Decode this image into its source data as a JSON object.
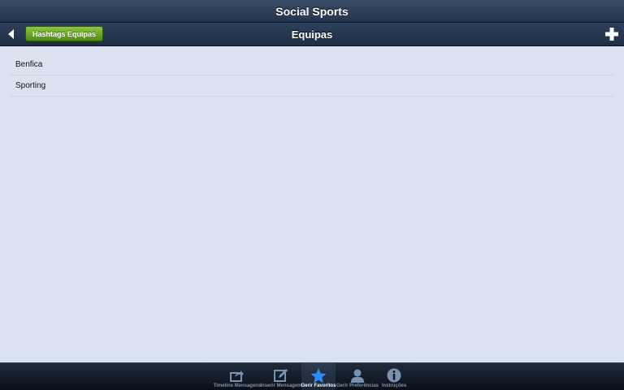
{
  "app": {
    "title": "Social Sports"
  },
  "navbar": {
    "title": "Equipas",
    "hashtags_label": "Hashtags Equipas",
    "back_icon": "back-arrow-icon",
    "add_icon": "plus-icon"
  },
  "list": {
    "items": [
      "Benfica",
      "Sporting"
    ]
  },
  "tabbar": {
    "tabs": [
      {
        "label": "Timeline Mensagens",
        "icon": "share-icon",
        "active": false
      },
      {
        "label": "Inserir Mensagem",
        "icon": "compose-icon",
        "active": false
      },
      {
        "label": "Gerir Favoritos",
        "icon": "star-icon",
        "active": true
      },
      {
        "label": "Gerir Preferências",
        "icon": "user-icon",
        "active": false
      },
      {
        "label": "Instruções",
        "icon": "info-icon",
        "active": false
      }
    ]
  },
  "colors": {
    "accent_green": "#5fa020",
    "active_star": "#2f8cff",
    "background": "#d9e2ee"
  }
}
